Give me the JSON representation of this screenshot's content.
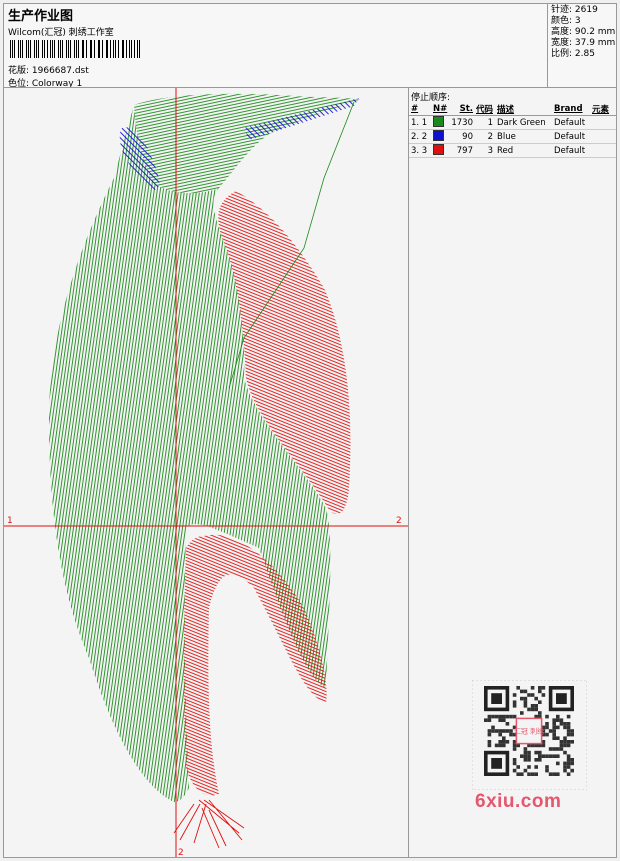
{
  "header": {
    "title": "生产作业图",
    "studio": "Wilcom(汇冠) 刺绣工作室",
    "design_label": "花版: 1966687.dst",
    "colorway_label": "色位: Colorway 1"
  },
  "stats": {
    "stitches": "针迹: 2619",
    "colors": "颜色: 3",
    "height": "高度: 90.2 mm",
    "width": "宽度: 37.9 mm",
    "ratio": "比例: 2.85"
  },
  "axes": {
    "marker1": "1",
    "marker2": "2"
  },
  "stop_sequence": {
    "title": "停止顺序:",
    "headers": [
      "#",
      "N#",
      "St.",
      "代码",
      "描述",
      "Brand",
      "元素"
    ],
    "rows": [
      {
        "num": "1. 1",
        "color": "#1a8a1a",
        "st": "1730",
        "code": "1",
        "desc": "Dark Green",
        "brand": "Default"
      },
      {
        "num": "2. 2",
        "color": "#1010d0",
        "st": "90",
        "code": "2",
        "desc": "Blue",
        "brand": "Default"
      },
      {
        "num": "3. 3",
        "color": "#e01010",
        "st": "797",
        "code": "3",
        "desc": "Red",
        "brand": "Default"
      }
    ]
  },
  "watermark": {
    "text": "6xiu.com",
    "stamp": "汇冠 刺绣"
  }
}
